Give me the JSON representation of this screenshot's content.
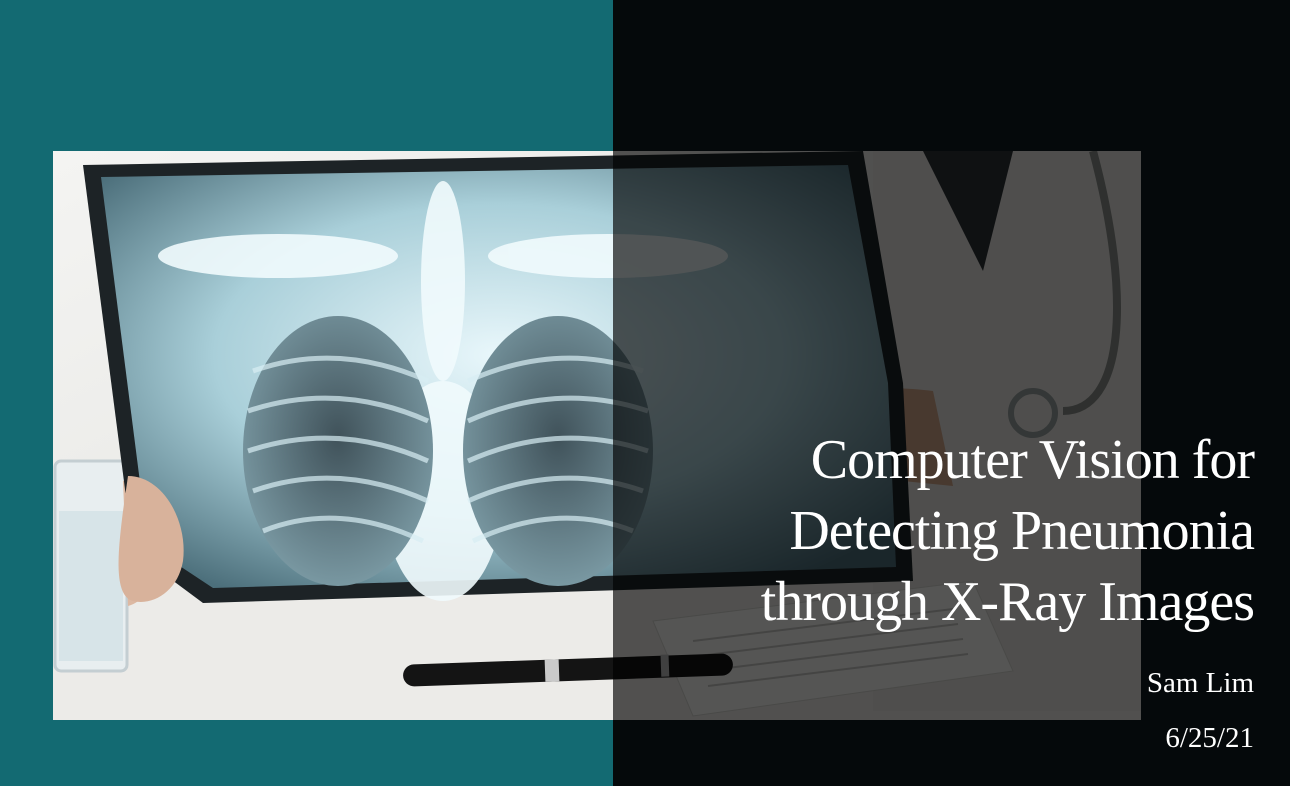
{
  "slide": {
    "title_lines": [
      "Computer Vision for",
      "Detecting Pneumonia",
      "through X-Ray Images"
    ],
    "author": "Sam Lim",
    "date": "6/25/21"
  },
  "colors": {
    "teal_panel": "#136a72",
    "dark_panel": "#05090b",
    "text": "#ffffff"
  },
  "photo": {
    "subject": "doctor holding chest x-ray film"
  }
}
